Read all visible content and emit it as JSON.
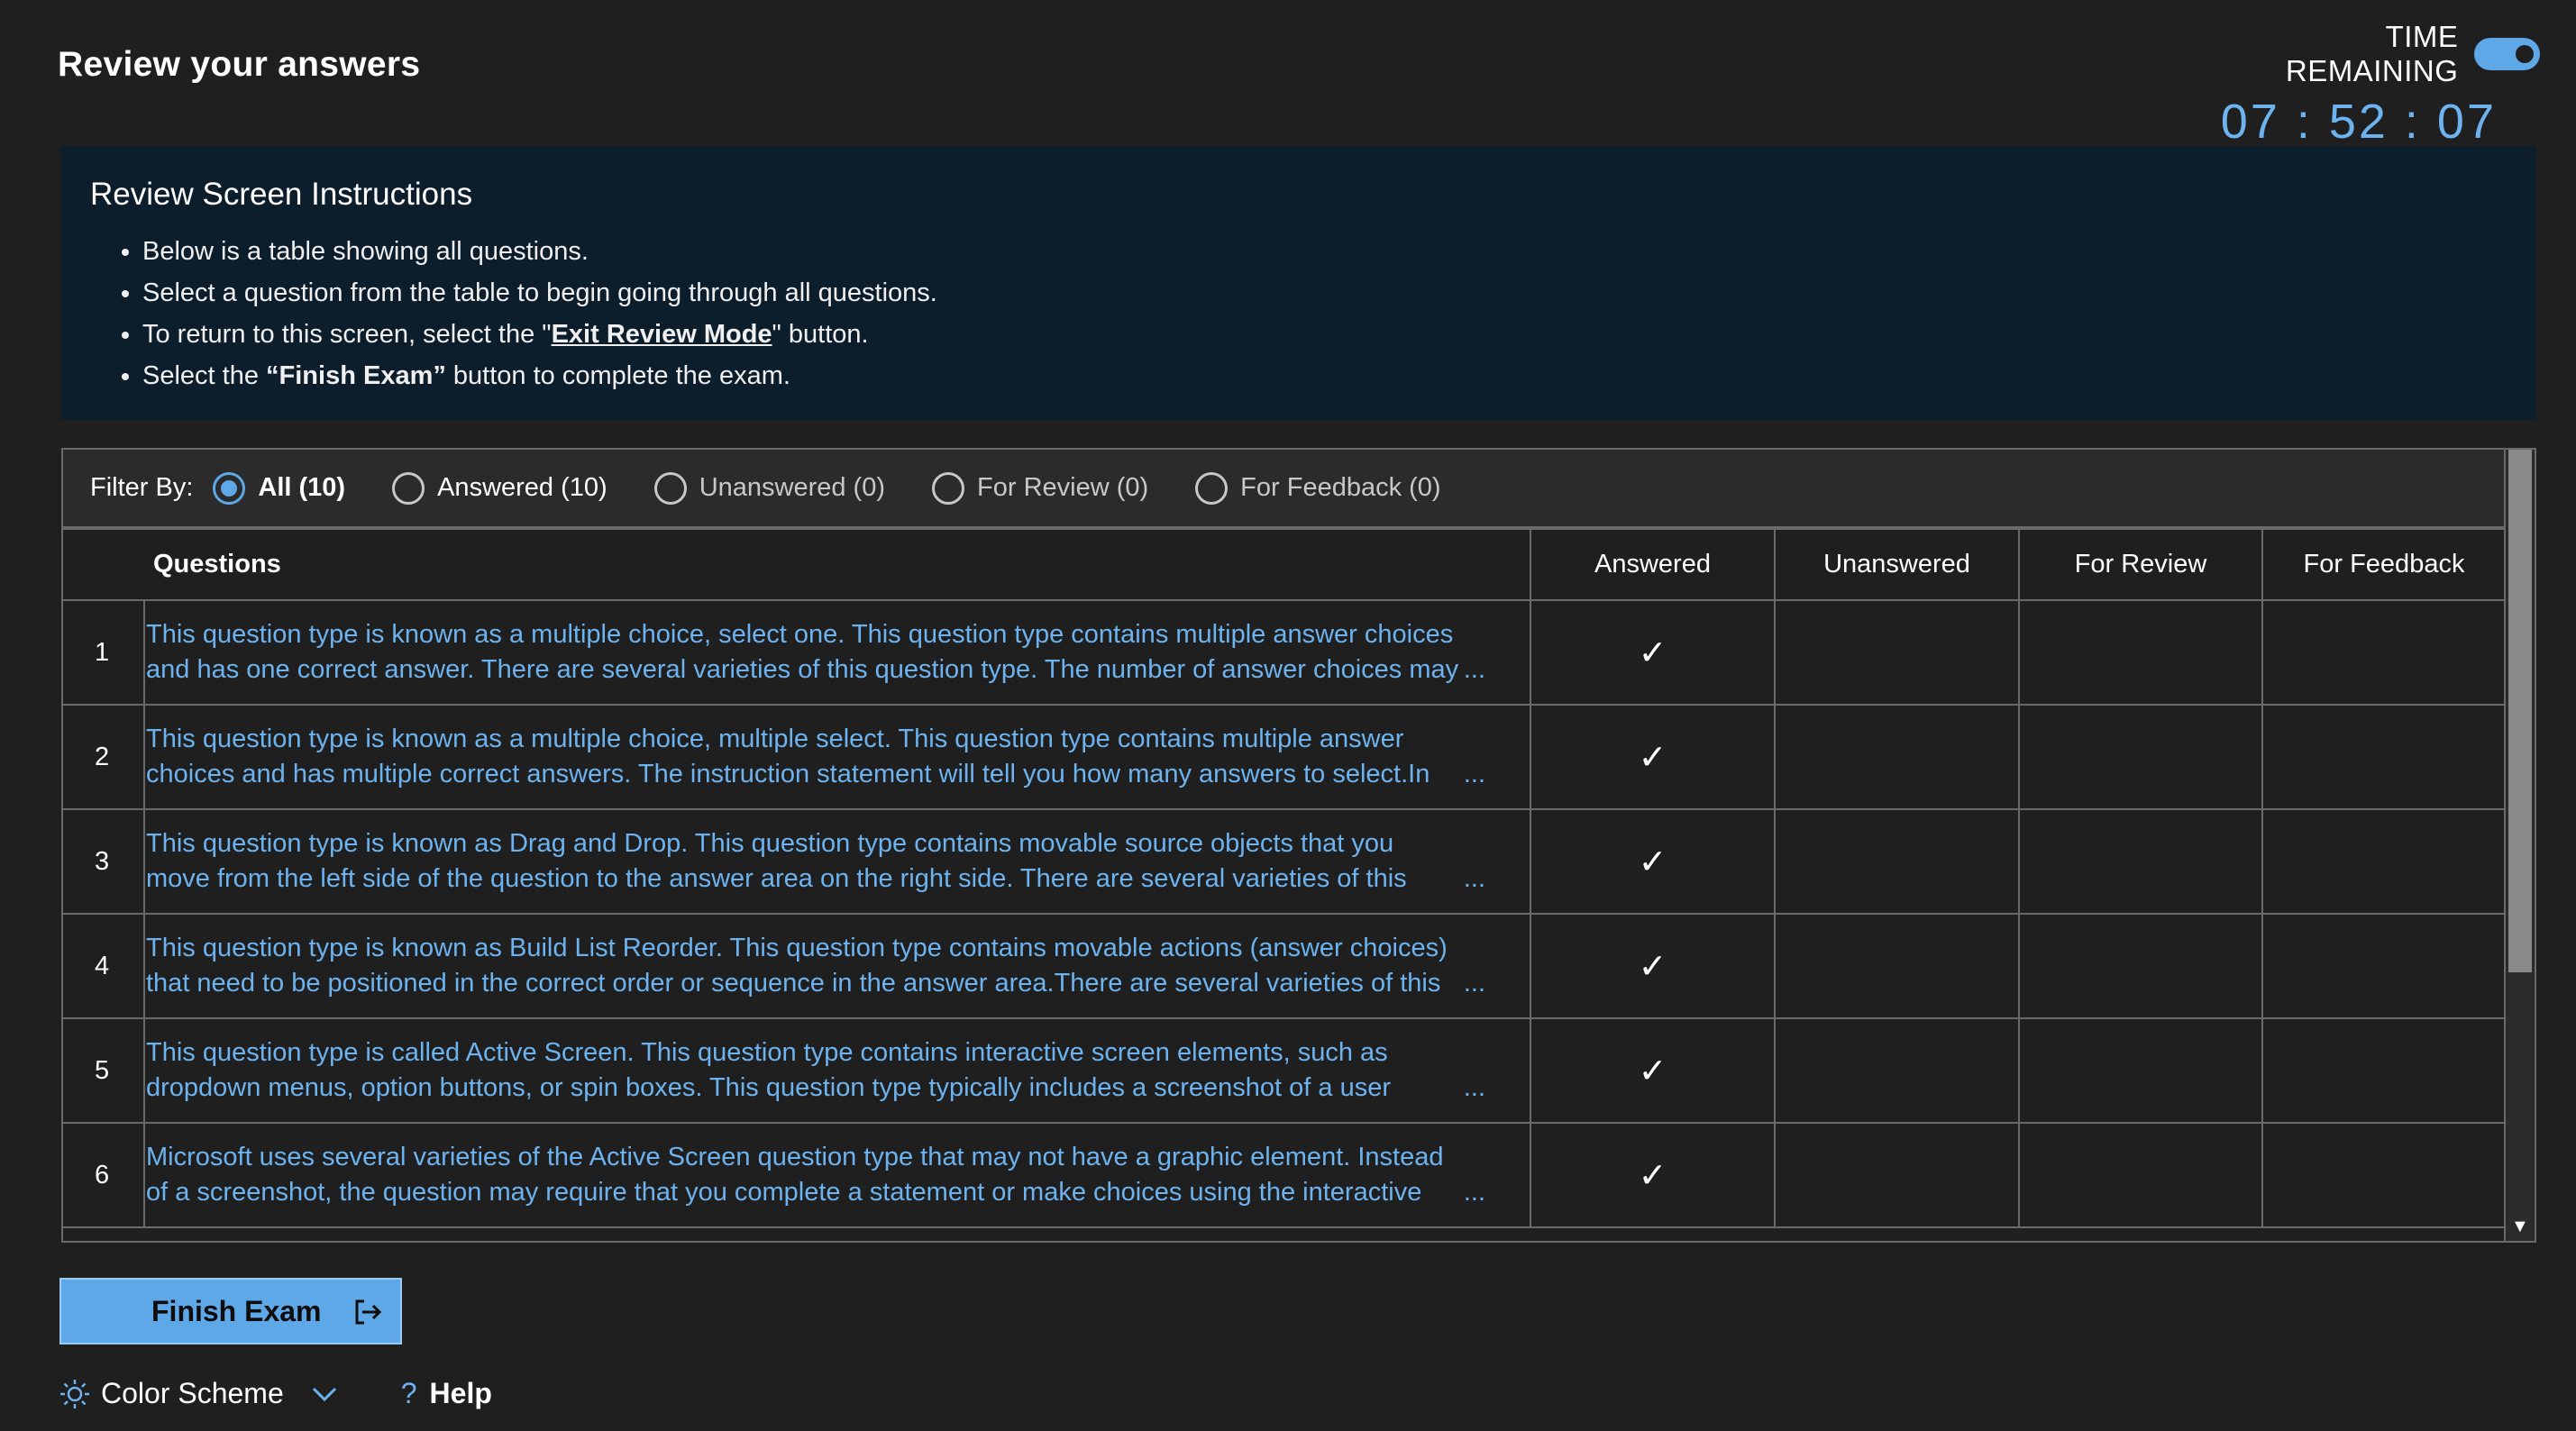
{
  "header": {
    "title": "Review your answers",
    "timer_label": "TIME REMAINING",
    "timer_value": "07 : 52 : 07"
  },
  "instructions": {
    "title": "Review Screen Instructions",
    "bullet1": "Below is a table showing all questions.",
    "bullet2": "Select a question from the table to begin going through all questions.",
    "bullet3_pre": "To return to this screen, select the \"",
    "bullet3_link": "Exit Review Mode",
    "bullet3_post": "\" button.",
    "bullet4_pre": "Select the ",
    "bullet4_bold": "“Finish Exam”",
    "bullet4_post": " button to complete the exam."
  },
  "filter": {
    "label": "Filter By:",
    "options": [
      {
        "label": "All (10)",
        "selected": true
      },
      {
        "label": "Answered (10)",
        "selected": false
      },
      {
        "label": "Unanswered (0)",
        "selected": false
      },
      {
        "label": "For Review (0)",
        "selected": false
      },
      {
        "label": "For Feedback (0)",
        "selected": false
      }
    ]
  },
  "table": {
    "headers": [
      "Questions",
      "Answered",
      "Unanswered",
      "For Review",
      "For Feedback"
    ],
    "rows": [
      {
        "num": "1",
        "line1": "This question type is known as a multiple choice, select one. This question type contains multiple answer choices",
        "line2": "and has one correct answer. There are several varieties of this question type. The number of answer choices may",
        "answered": "✓"
      },
      {
        "num": "2",
        "line1": "This question type is known as a multiple choice, multiple select. This question type contains multiple answer",
        "line2": "choices and has multiple correct answers. The instruction statement will tell you how many answers to select.In",
        "answered": "✓"
      },
      {
        "num": "3",
        "line1": "This question type is known as Drag and Drop. This question type contains movable source objects that you",
        "line2": "move from the left side of the question to the answer area on the right side. There are several varieties of this",
        "answered": "✓"
      },
      {
        "num": "4",
        "line1": "This question type is known as Build List Reorder. This question type contains movable actions (answer choices)",
        "line2": "that need to be positioned in the correct order or sequence in the answer area.There are several varieties of this",
        "answered": "✓"
      },
      {
        "num": "5",
        "line1": "This question type is called Active Screen. This question type contains interactive screen elements, such as",
        "line2": "dropdown menus, option buttons, or spin boxes. This question type typically includes a screenshot of a user",
        "answered": "✓"
      },
      {
        "num": "6",
        "line1": "Microsoft uses several varieties of the Active Screen question type that may not have a graphic element. Instead",
        "line2": "of a screenshot, the question may require that you complete a statement or make choices using the interactive",
        "answered": "✓"
      }
    ],
    "ellipsis": "..."
  },
  "actions": {
    "finish_label": "Finish Exam",
    "color_scheme_label": "Color Scheme",
    "help_label": "Help",
    "help_glyph": "?"
  },
  "icons": {
    "toggle": "toggle-switch-icon",
    "finish": "exit-arrow-icon",
    "color_scheme": "sun-icon",
    "dropdown": "chevron-down-icon",
    "help": "question-mark-icon",
    "check": "checkmark-icon",
    "scroll_down": "scroll-down-arrow-icon"
  },
  "colors": {
    "background": "#1f1f1f",
    "accent": "#5ea8e8",
    "link_text": "#6db3ef",
    "instructions_bg": "#0c1d2b"
  }
}
